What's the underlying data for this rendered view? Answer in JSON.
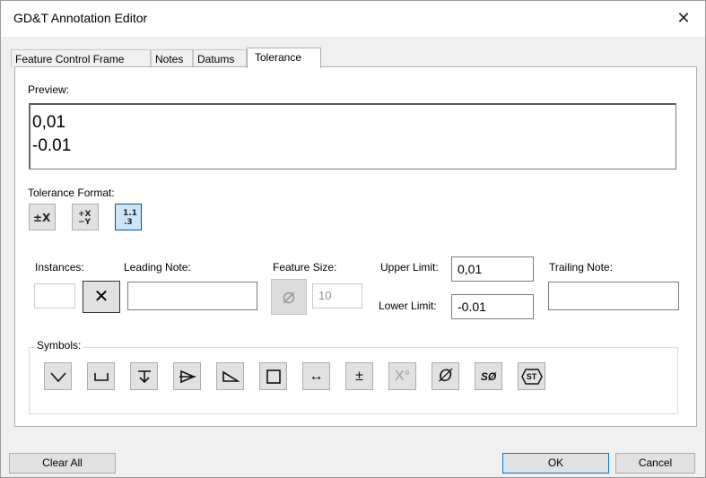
{
  "window": {
    "title": "GD&T Annotation Editor",
    "close_glyph": "✕"
  },
  "tabs": [
    {
      "label": "Feature Control Frame",
      "active": false
    },
    {
      "label": "Notes",
      "active": false
    },
    {
      "label": "Datums",
      "active": false
    },
    {
      "label": "Tolerance",
      "active": true
    }
  ],
  "preview": {
    "label": "Preview:",
    "lines": [
      "0,01",
      "-0.01"
    ]
  },
  "tolerance_format": {
    "label": "Tolerance Format:",
    "buttons": [
      {
        "name": "plus-minus-symmetric",
        "selected": false
      },
      {
        "name": "plus-minus-deviation",
        "selected": false
      },
      {
        "name": "limits-stacked",
        "selected": true
      }
    ]
  },
  "fields": {
    "instances_label": "Instances:",
    "instances_value": "",
    "multiply_glyph": "✕",
    "leading_note_label": "Leading Note:",
    "leading_note_value": "",
    "feature_size_label": "Feature Size:",
    "diameter_glyph": "⌀",
    "feature_size_value": "10",
    "upper_limit_label": "Upper Limit:",
    "upper_limit_value": "0,01",
    "lower_limit_label": "Lower Limit:",
    "lower_limit_value": "-0.01",
    "trailing_note_label": "Trailing Note:",
    "trailing_note_value": ""
  },
  "symbols": {
    "label": "Symbols:",
    "items": [
      {
        "icon": "countersink-icon"
      },
      {
        "icon": "counterbore-icon"
      },
      {
        "icon": "depth-icon"
      },
      {
        "icon": "conical-taper-icon"
      },
      {
        "icon": "slope-icon"
      },
      {
        "icon": "square-icon"
      },
      {
        "icon": "between-icon",
        "glyph": "↔"
      },
      {
        "icon": "plus-minus-icon",
        "glyph": "±"
      },
      {
        "icon": "degree-icon",
        "glyph": "X°",
        "disabled": true
      },
      {
        "icon": "diameter-icon",
        "glyph": "Ø"
      },
      {
        "icon": "spherical-diameter-icon",
        "glyph": "SØ"
      },
      {
        "icon": "statistical-tolerance-icon",
        "glyph": "ST"
      }
    ]
  },
  "buttons": {
    "clear_all": "Clear All",
    "ok": "OK",
    "cancel": "Cancel"
  }
}
